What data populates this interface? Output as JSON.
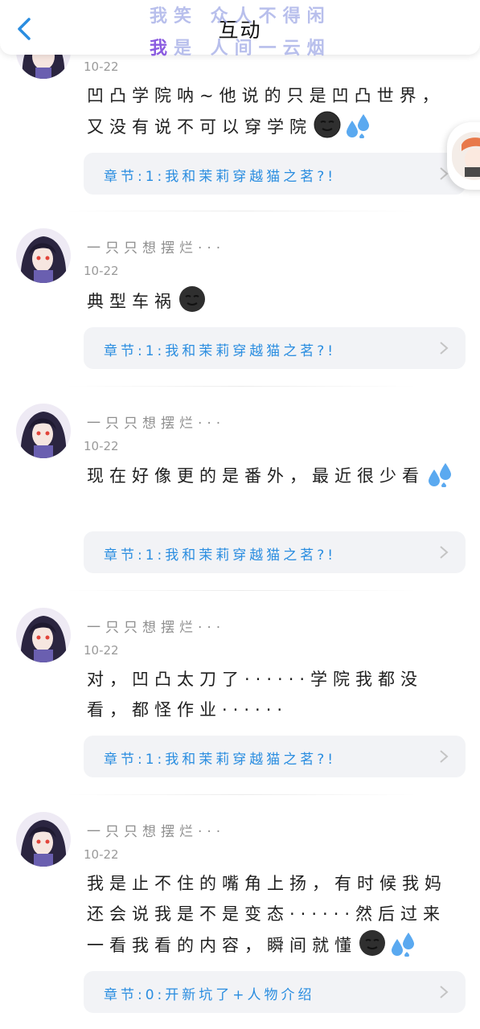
{
  "header": {
    "title": "互动",
    "back_icon": "chevron-left-icon",
    "watermark_line1": "我笑 众人不得闲",
    "watermark_line2_first": "我",
    "watermark_line2_rest": "是 人间一云烟"
  },
  "comments": [
    {
      "username": "",
      "date": "10-22",
      "content": "凹凸学院呐~他说的只是凹凸世界，又没有说不可以穿学院",
      "emojis": [
        "dark-moon-face-emoji",
        "sweat-droplets-emoji"
      ],
      "chapter": "章节:1:我和茉莉穿越猫之茗?!"
    },
    {
      "username": "一只只想摆烂···",
      "date": "10-22",
      "content": "典型车祸",
      "emojis": [
        "dark-moon-face-emoji"
      ],
      "chapter": "章节:1:我和茉莉穿越猫之茗?!"
    },
    {
      "username": "一只只想摆烂···",
      "date": "10-22",
      "content": "现在好像更的是番外，最近很少看",
      "emojis": [
        "sweat-droplets-emoji"
      ],
      "chapter": "章节:1:我和茉莉穿越猫之茗?!"
    },
    {
      "username": "一只只想摆烂···",
      "date": "10-22",
      "content": "对，凹凸太刀了······学院我都没看，都怪作业······",
      "emojis": [],
      "chapter": "章节:1:我和茉莉穿越猫之茗?!"
    },
    {
      "username": "一只只想摆烂···",
      "date": "10-22",
      "content": "我是止不住的嘴角上扬，有时候我妈还会说我是不是变态······然后过来一看我看的内容，瞬间就懂",
      "emojis": [
        "dark-moon-face-emoji",
        "sweat-droplets-emoji"
      ],
      "chapter": "章节:0:开新坑了+人物介绍"
    }
  ],
  "colors": {
    "accent_link": "#2a8de0",
    "back_icon": "#2a8de0",
    "card_background": "#f2f3f6",
    "username": "#8f8f8f",
    "watermark": "#a0aae6"
  }
}
